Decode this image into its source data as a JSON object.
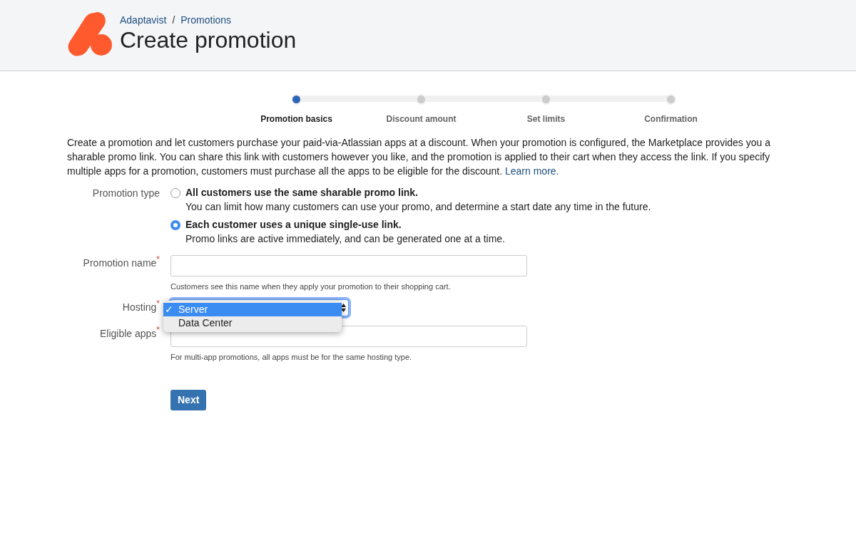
{
  "header": {
    "breadcrumbs": [
      "Adaptavist",
      "Promotions"
    ],
    "separator": "/",
    "title": "Create promotion"
  },
  "steps": [
    {
      "label": "Promotion basics",
      "selected": true
    },
    {
      "label": "Discount amount",
      "selected": false
    },
    {
      "label": "Set limits",
      "selected": false
    },
    {
      "label": "Confirmation",
      "selected": false
    }
  ],
  "intro": {
    "text": "Create a promotion and let customers purchase your paid-via-Atlassian apps at a discount. When your promotion is configured, the Marketplace provides you a sharable promo link. You can share this link with customers however you like, and the promotion is applied to their cart when they access the link. If you specify multiple apps for a promotion, customers must purchase all the apps to be eligible for the discount.",
    "link": "Learn more."
  },
  "promotion_type": {
    "label": "Promotion type",
    "options": [
      {
        "title": "All customers use the same sharable promo link.",
        "description": "You can limit how many customers can use your promo, and determine a start date any time in the future.",
        "selected": false
      },
      {
        "title": "Each customer uses a unique single-use link.",
        "description": "Promo links are active immediately, and can be generated one at a time.",
        "selected": true
      }
    ]
  },
  "promotion_name": {
    "label": "Promotion name",
    "required_mark": "*",
    "help": "Customers see this name when they apply your promotion to their shopping cart."
  },
  "hosting": {
    "label": "Hosting",
    "required_mark": "*",
    "expanded": true,
    "check": "✓",
    "options": [
      {
        "label": "Server",
        "selected": true
      },
      {
        "label": "Data Center",
        "selected": false
      }
    ]
  },
  "eligible_apps": {
    "label": "Eligible apps",
    "required_mark": "*",
    "help": "For multi-app promotions, all apps must be for the same hosting type."
  },
  "next_button": "Next"
}
